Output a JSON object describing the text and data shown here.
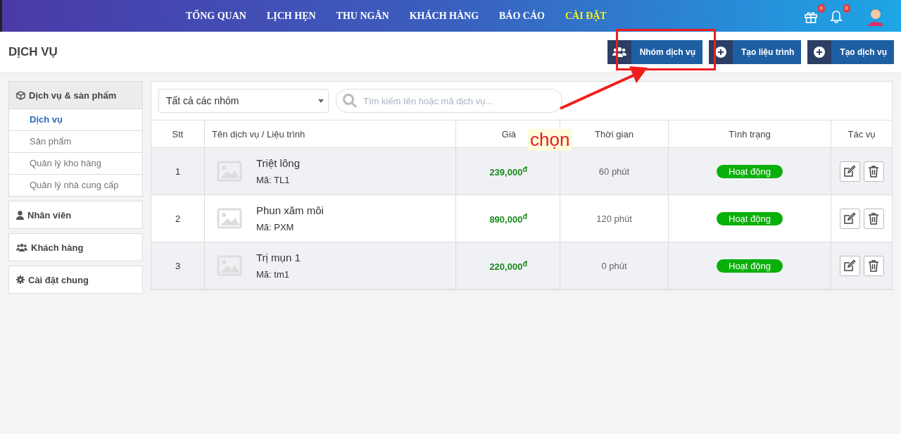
{
  "nav": {
    "items": [
      {
        "label": "TỔNG QUAN",
        "selected": false
      },
      {
        "label": "LỊCH HẸN",
        "selected": false
      },
      {
        "label": "THU NGÂN",
        "selected": false
      },
      {
        "label": "KHÁCH HÀNG",
        "selected": false
      },
      {
        "label": "BÁO CÁO",
        "selected": false
      },
      {
        "label": "CÀI ĐẶT",
        "selected": true
      }
    ],
    "badges": [
      {
        "kind": "gift",
        "count": "0"
      },
      {
        "kind": "bell",
        "count": "0"
      }
    ]
  },
  "page_title": "DỊCH VỤ",
  "actions": [
    {
      "kind": "group",
      "label": "Nhóm dịch vụ"
    },
    {
      "kind": "add",
      "label": "Tạo liệu trình"
    },
    {
      "kind": "add",
      "label": "Tạo dịch vụ"
    }
  ],
  "sidebar": [
    {
      "kind": "box",
      "label": "Dịch vụ & sản phẩm",
      "expanded": true,
      "children": [
        {
          "label": "Dịch vụ",
          "selected": true
        },
        {
          "label": "Sản phẩm",
          "selected": false
        },
        {
          "label": "Quản lý kho hàng",
          "selected": false
        },
        {
          "label": "Quản lý nhà cung cấp",
          "selected": false
        }
      ]
    },
    {
      "kind": "user",
      "label": "Nhân viên",
      "expanded": false
    },
    {
      "kind": "users",
      "label": "Khách hàng",
      "expanded": false
    },
    {
      "kind": "gear",
      "label": "Cài đặt chung",
      "expanded": false
    }
  ],
  "filter": {
    "value": "Tất cả các nhóm"
  },
  "search": {
    "placeholder": "Tìm kiếm tên hoặc mã dịch vụ..."
  },
  "table": {
    "columns": [
      "Stt",
      "Tên dịch vụ / Liệu trình",
      "Giá",
      "Thời gian",
      "Tình trạng",
      "Tác vụ"
    ],
    "rows": [
      {
        "stt": "1",
        "name": "Triệt lông",
        "code": "Mã: TL1",
        "price": "239,000$^{đ}$",
        "duration": "60 phút",
        "status": "Hoạt động"
      },
      {
        "stt": "2",
        "name": "Phun xăm môi",
        "code": "Mã: PXM",
        "price": "890,000$^{đ}$",
        "duration": "120 phút",
        "status": "Hoạt động"
      },
      {
        "stt": "3",
        "name": "Trị mụn 1",
        "code": "Mã: tm1",
        "price": "220,000$^{đ}$",
        "duration": "0 phút",
        "status": "Hoạt động"
      }
    ]
  },
  "annotation": {
    "caption": "chọn"
  }
}
